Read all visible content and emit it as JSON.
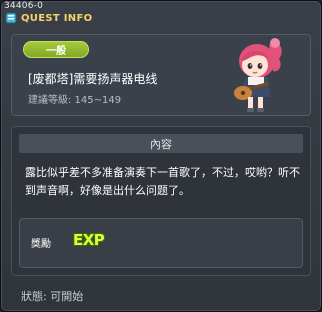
{
  "window": {
    "quest_id": "34406-0",
    "title": "QUEST INFO"
  },
  "quest": {
    "category": "一般",
    "name": "[废都塔]需要扬声器电线",
    "level": "建議等級: 145~149"
  },
  "content": {
    "header": "內容",
    "description": "露比似乎差不多准备演奏下一首歌了，不过，哎哟？听不到声音啊，好像是出什么问题了。"
  },
  "reward": {
    "label": "獎勵",
    "items": [
      "EXP"
    ]
  },
  "status": {
    "text": "狀態:  可開始"
  },
  "colors": {
    "title": "#f3d36a",
    "badge": "#8fb52c",
    "exp": "#d8ff3a"
  }
}
